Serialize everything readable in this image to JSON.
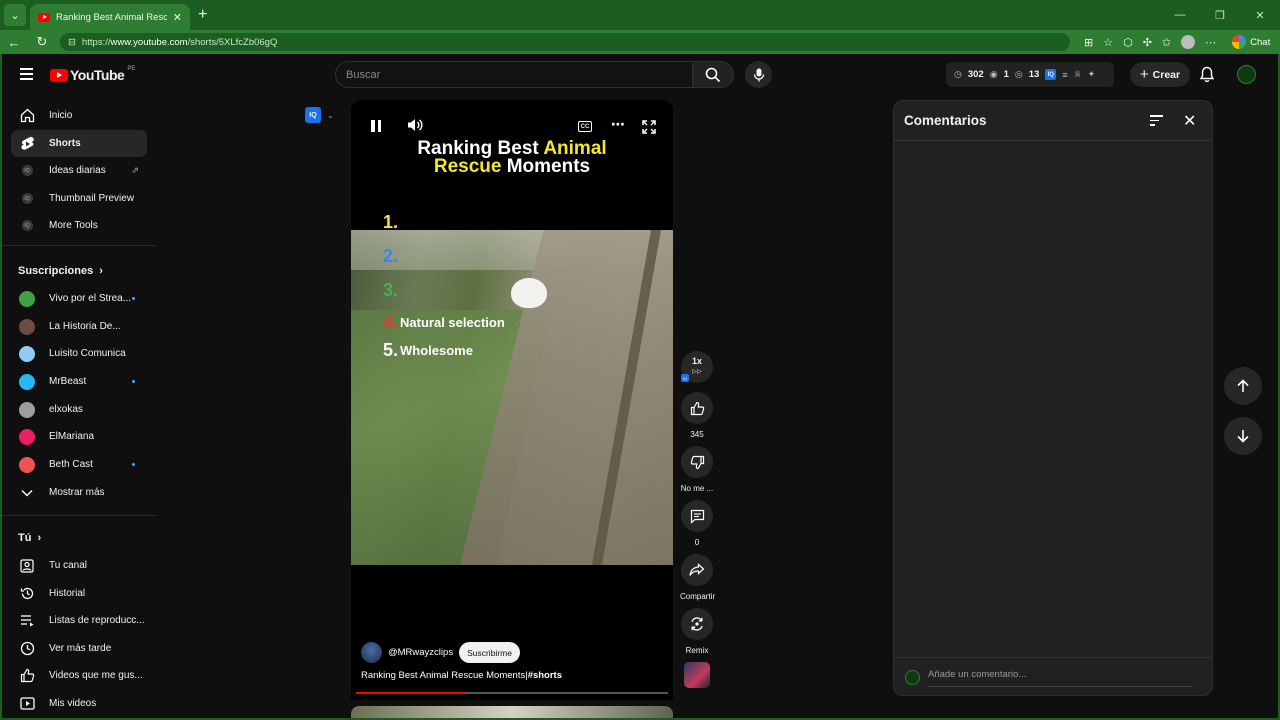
{
  "browser": {
    "tab_title": "Ranking Best Animal Rescue Mom",
    "url_prefix": "https://",
    "url_host": "www.youtube.com",
    "url_path": "/shorts/5XLfcZb06gQ",
    "chat_label": "Chat"
  },
  "header": {
    "logo_text": "YouTube",
    "region": "PE",
    "search_placeholder": "Buscar",
    "stats": {
      "a": "302",
      "b": "1",
      "c": "13"
    },
    "create_label": "Crear"
  },
  "sidebar": {
    "main": [
      {
        "label": "Inicio"
      },
      {
        "label": "Shorts"
      },
      {
        "label": "Ideas diarias"
      },
      {
        "label": "Thumbnail Preview"
      },
      {
        "label": "More Tools"
      }
    ],
    "subs_heading": "Suscripciones",
    "subs": [
      {
        "label": "Vivo por el Strea...",
        "color": "#43a047"
      },
      {
        "label": "La Historia De...",
        "color": "#6d4c41"
      },
      {
        "label": "Luisito Comunica",
        "color": "#90caf9"
      },
      {
        "label": "MrBeast",
        "color": "#29b6f6"
      },
      {
        "label": "elxokas",
        "color": "#9e9e9e"
      },
      {
        "label": "ElMariana",
        "color": "#e91e63"
      },
      {
        "label": "Beth Cast",
        "color": "#ef5350"
      }
    ],
    "show_more": "Mostrar más",
    "you_heading": "Tú",
    "you": [
      {
        "label": "Tu canal"
      },
      {
        "label": "Historial"
      },
      {
        "label": "Listas de reproducc..."
      },
      {
        "label": "Ver más tarde"
      },
      {
        "label": "Videos que me gus..."
      },
      {
        "label": "Mis videos"
      }
    ]
  },
  "player": {
    "title_line1_white": "Ranking Best ",
    "title_line1_yellow": "Animal",
    "title_line2_yellow": "Rescue",
    "title_line2_white": " Moments",
    "ranks": [
      {
        "num": "1.",
        "text": "",
        "color": "#f6e531"
      },
      {
        "num": "2.",
        "text": "",
        "color": "#3b82f6"
      },
      {
        "num": "3.",
        "text": "",
        "color": "#4caf50"
      },
      {
        "num": "4.",
        "text": "Natural selection",
        "color": "#e53935"
      },
      {
        "num": "5.",
        "text": "Wholesome",
        "color": "#ffffff"
      }
    ],
    "channel": "@MRwayzclips",
    "subscribe_label": "Suscribirme",
    "caption_plain": "Ranking Best Animal Rescue Moments|",
    "caption_tag": "#shorts",
    "progress": 0.35
  },
  "actions": {
    "speed": "1x",
    "likes": "345",
    "dislike_label": "No me ...",
    "comments_count": "0",
    "share_label": "Compartir",
    "remix_label": "Remix"
  },
  "comments": {
    "title": "Comentarios",
    "placeholder": "Añade un comentario..."
  },
  "colors": {
    "accent_red": "#ff0000",
    "browser_green": "#2e7d32",
    "title_yellow": "#f6e531"
  }
}
